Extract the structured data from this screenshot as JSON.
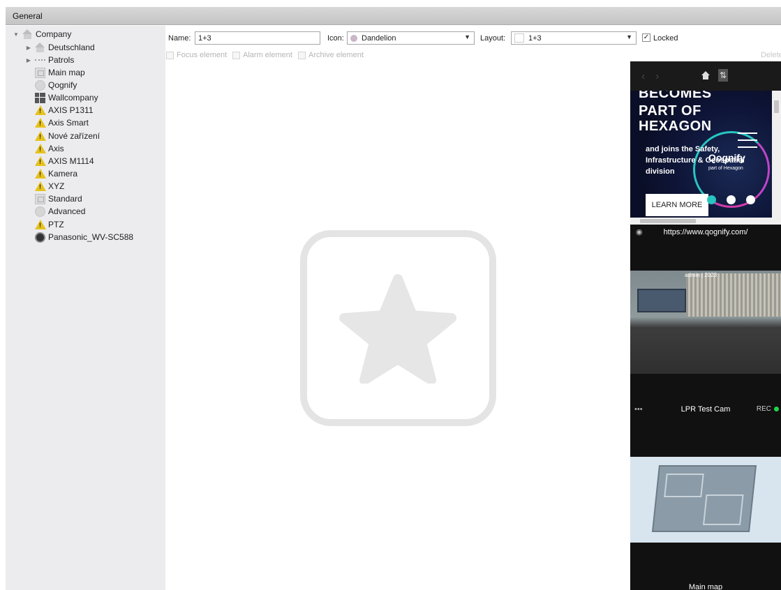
{
  "window": {
    "title": "General"
  },
  "tree": {
    "root": "Company",
    "items": [
      {
        "label": "Deutschland",
        "icon": "house-icon"
      },
      {
        "label": "Patrols",
        "icon": "patrol-icon"
      },
      {
        "label": "Main map",
        "icon": "map-icon"
      },
      {
        "label": "Qognify",
        "icon": "globe-icon"
      },
      {
        "label": "Wallcompany",
        "icon": "grid-icon"
      },
      {
        "label": "AXIS P1311",
        "icon": "warning-icon"
      },
      {
        "label": "Axis Smart",
        "icon": "warning-icon"
      },
      {
        "label": "Nové zařízení",
        "icon": "warning-icon"
      },
      {
        "label": "Axis",
        "icon": "warning-icon"
      },
      {
        "label": "AXIS M1114",
        "icon": "warning-icon"
      },
      {
        "label": "Kamera",
        "icon": "warning-icon"
      },
      {
        "label": "XYZ",
        "icon": "warning-icon"
      },
      {
        "label": "Standard",
        "icon": "map-icon"
      },
      {
        "label": "Advanced",
        "icon": "globe-icon"
      },
      {
        "label": "PTZ",
        "icon": "warning-icon"
      },
      {
        "label": "Panasonic_WV-SC588",
        "icon": "camera-icon"
      }
    ]
  },
  "toolbar": {
    "name_label": "Name:",
    "name_value": "1+3",
    "icon_label": "Icon:",
    "icon_value": "Dandelion",
    "layout_label": "Layout:",
    "layout_value": "1+3",
    "locked_label": "Locked",
    "locked_checked": true,
    "focus_label": "Focus element",
    "alarm_label": "Alarm element",
    "archive_label": "Archive element",
    "delete_label": "Delete"
  },
  "preview": {
    "web": {
      "line1": "BECOMES",
      "line2": "PART OF",
      "line3": "HEXAGON",
      "brand": "Qognify",
      "sub_brand": "part of Hexagon",
      "line4": "and joins the Safety,",
      "line5": "Infrastructure & Geospatial",
      "line6": "division",
      "button": "LEARN MORE"
    },
    "url": "https://www.qognify.com/",
    "camera_title": "LPR Test Cam",
    "camera_status": "REC",
    "camera_overlay": "admin | 2023",
    "map_title": "Main map"
  },
  "colors": {
    "accent_teal": "#27c5c0",
    "rec_green": "#23d34a",
    "warning_yellow": "#e6c21c"
  }
}
